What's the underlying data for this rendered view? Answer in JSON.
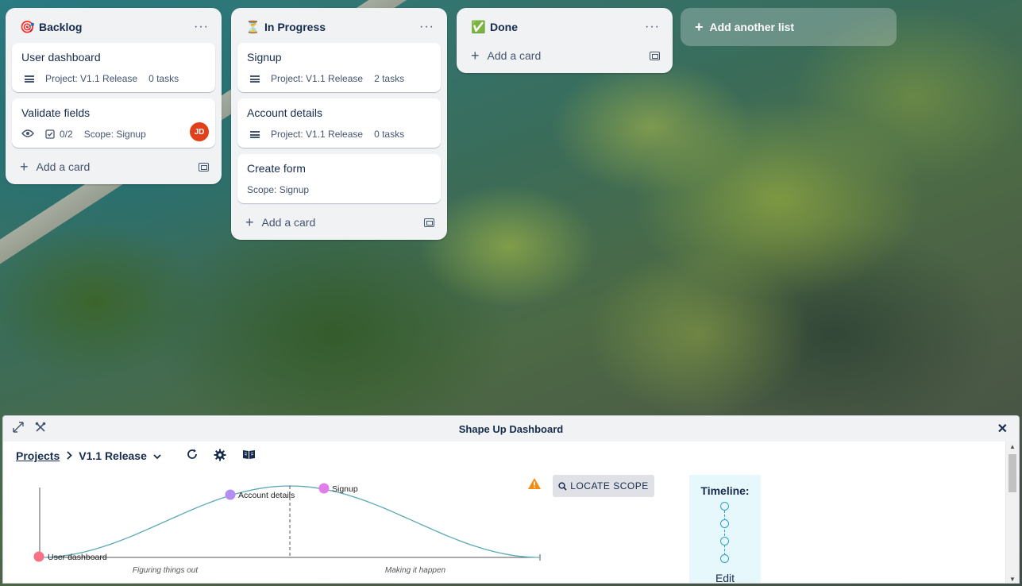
{
  "board": {
    "lists": [
      {
        "title": "Backlog",
        "emoji": "🎯",
        "cards": [
          {
            "title": "User dashboard",
            "project": "Project: V1.1 Release",
            "tasks": "0 tasks"
          },
          {
            "title": "Validate fields",
            "checklist": "0/2",
            "scope": "Scope: Signup",
            "avatar": "JD"
          }
        ],
        "add_card": "Add a card"
      },
      {
        "title": "In Progress",
        "emoji": "⏳",
        "cards": [
          {
            "title": "Signup",
            "project": "Project: V1.1 Release",
            "tasks": "2 tasks"
          },
          {
            "title": "Account details",
            "project": "Project: V1.1 Release",
            "tasks": "0 tasks"
          },
          {
            "title": "Create form",
            "scope": "Scope: Signup"
          }
        ],
        "add_card": "Add a card"
      },
      {
        "title": "Done",
        "emoji": "✅",
        "cards": [],
        "add_card": "Add a card"
      }
    ],
    "add_list": "Add another list"
  },
  "panel": {
    "title": "Shape Up Dashboard",
    "breadcrumb": {
      "projects": "Projects",
      "release": "V1.1 Release"
    },
    "hill": {
      "left_label": "Figuring things out",
      "right_label": "Making it happen",
      "points": [
        {
          "name": "User dashboard",
          "color": "#f87185"
        },
        {
          "name": "Account details",
          "color": "#b18ef0"
        },
        {
          "name": "Signup",
          "color": "#e27ce9"
        }
      ]
    },
    "locate_scope": "LOCATE SCOPE",
    "timeline": {
      "title": "Timeline:",
      "edit": "Edit"
    }
  },
  "colors": {
    "avatar": "#e2401a",
    "hill_curve": "#5aa9b5",
    "warning": "#f18d13",
    "timeline_bg": "#e7f8fd"
  }
}
